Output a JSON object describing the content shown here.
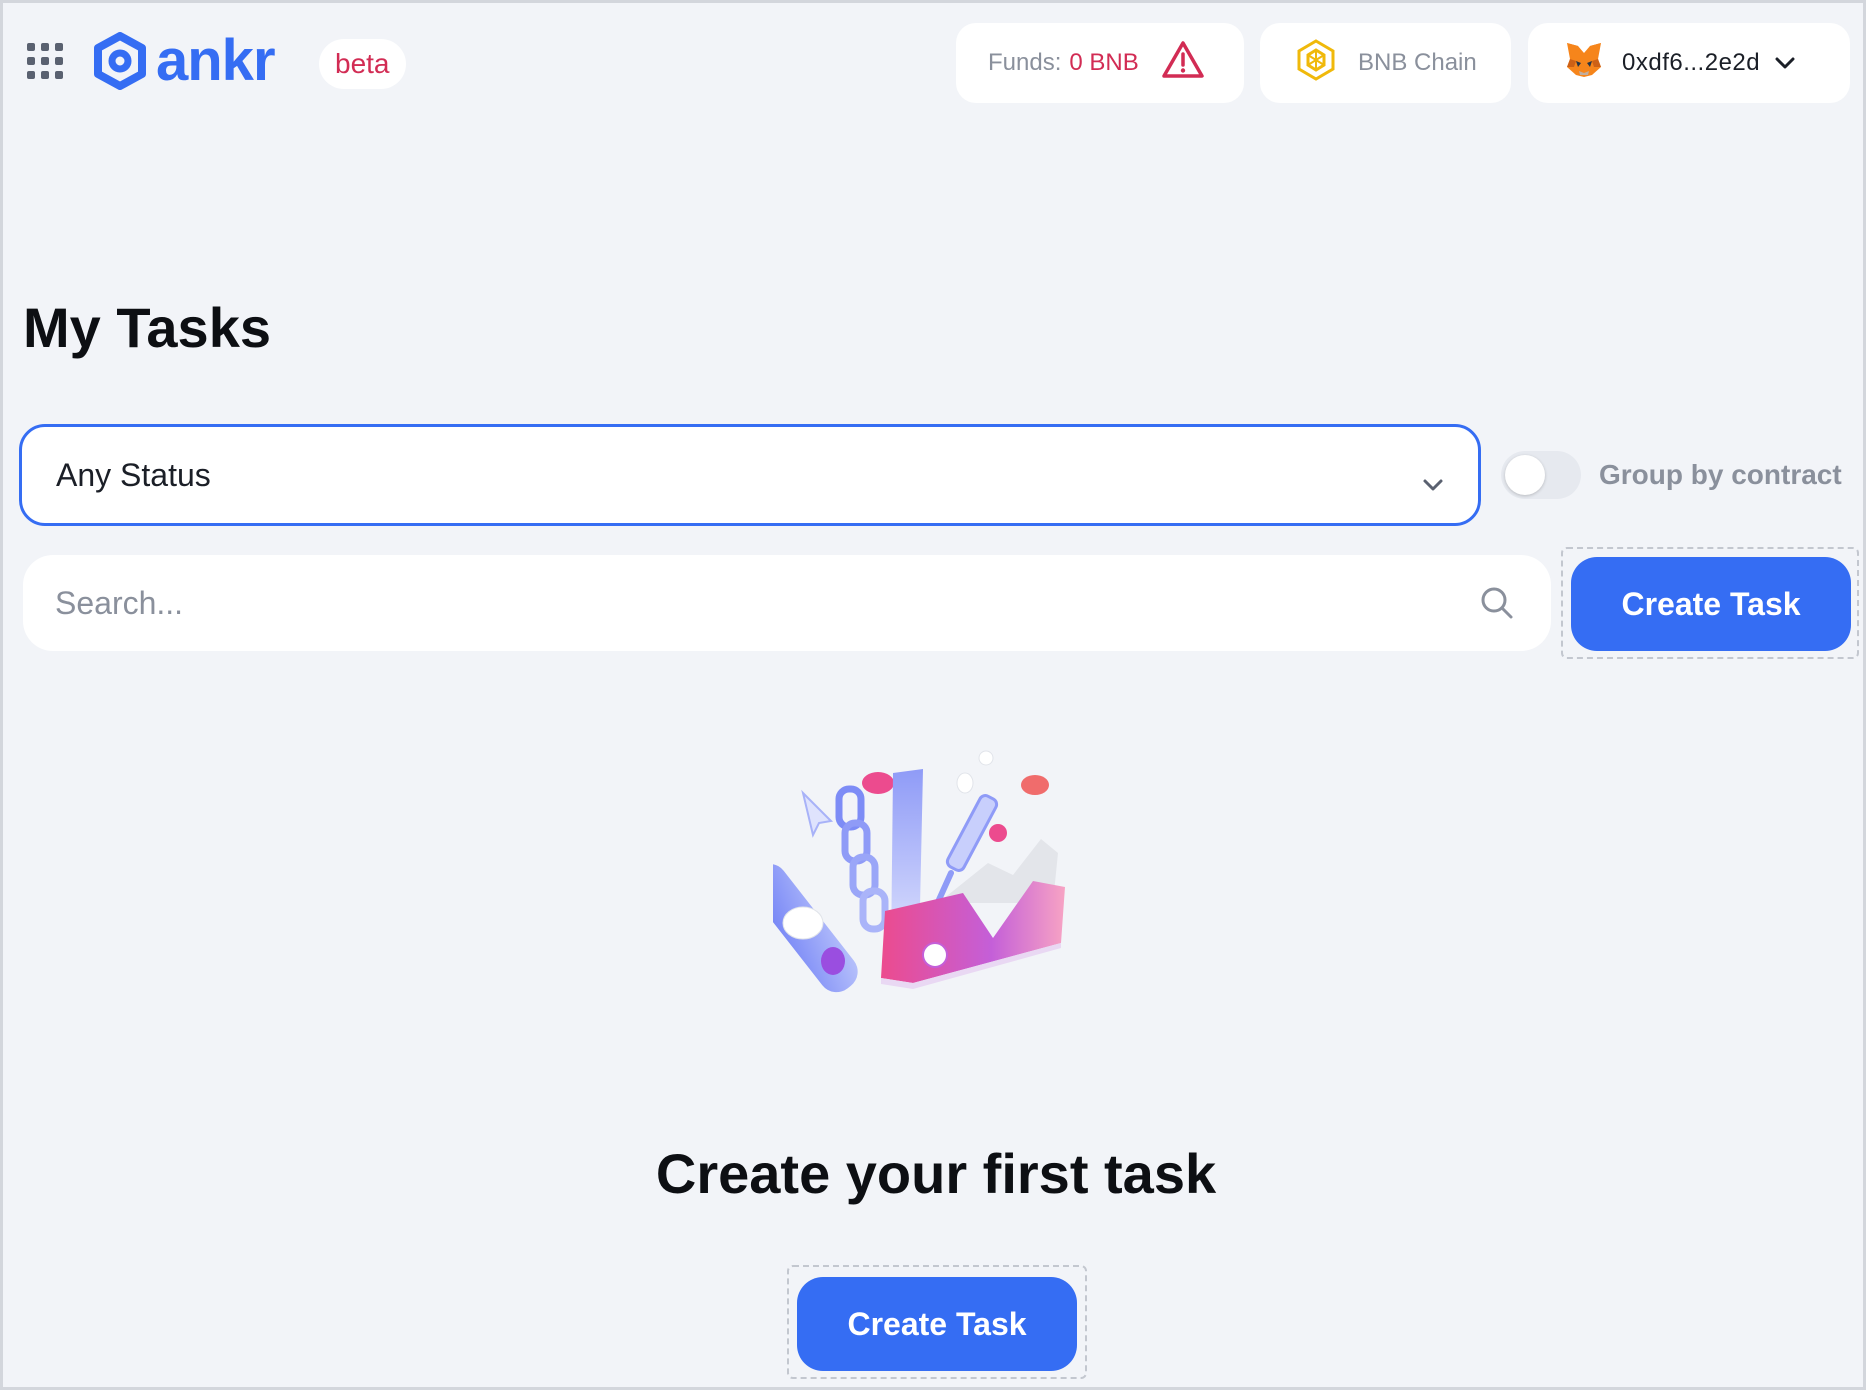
{
  "header": {
    "brand": "ankr",
    "beta_label": "beta",
    "funds_label": "Funds:",
    "funds_value": "0 BNB",
    "chain_label": "BNB Chain",
    "wallet_address": "0xdf6...2e2d"
  },
  "colors": {
    "accent": "#356df3",
    "warning": "#d22c54",
    "background": "#f2f4f8"
  },
  "icons": {
    "apps": "grid-icon",
    "warning": "warning-triangle-icon",
    "chain": "bnb-icon",
    "wallet": "metamask-fox-icon",
    "dropdown": "chevron-down-icon",
    "search": "search-icon"
  },
  "page": {
    "title": "My Tasks"
  },
  "filters": {
    "status_value": "Any Status",
    "group_by_label": "Group by contract",
    "group_by_enabled": false
  },
  "search": {
    "placeholder": "Search..."
  },
  "actions": {
    "create_task_label": "Create Task"
  },
  "empty_state": {
    "title": "Create your first task",
    "button_label": "Create Task"
  }
}
